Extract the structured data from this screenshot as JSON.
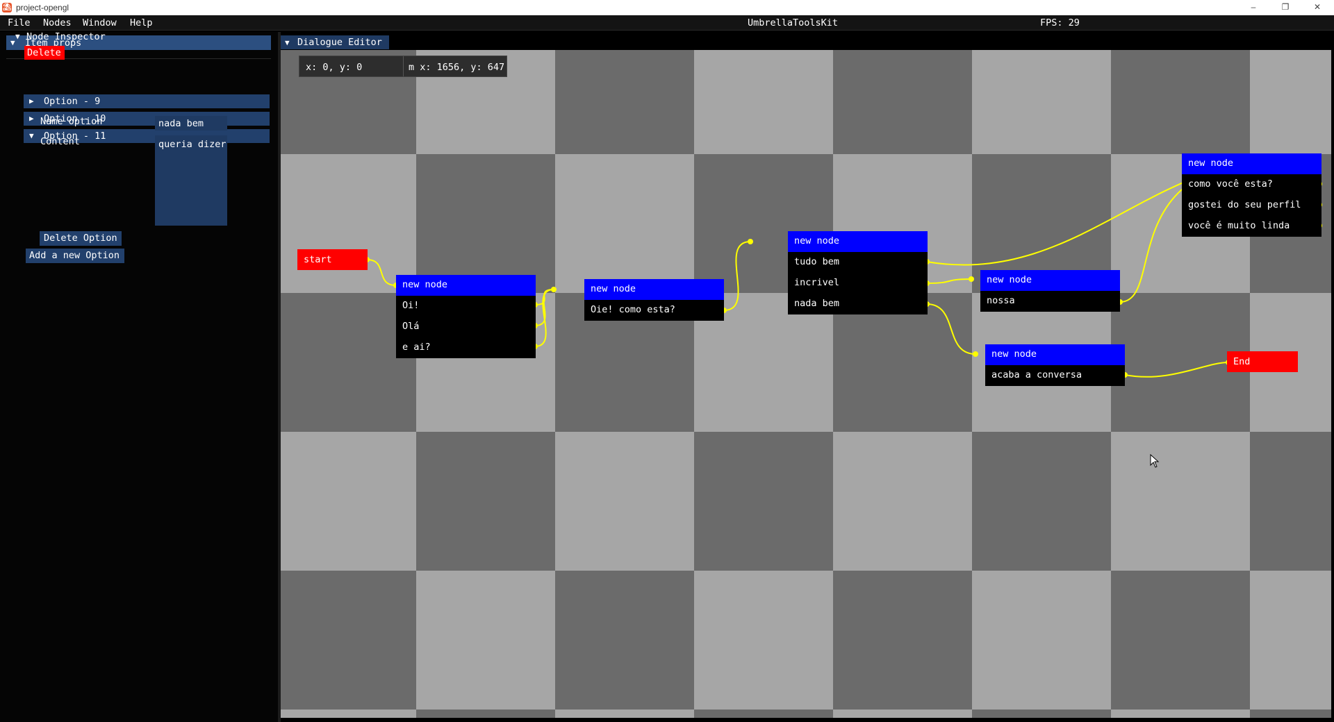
{
  "window": {
    "title": "project-opengl",
    "app_icon": "app-logo-icon",
    "controls": {
      "minimize": "–",
      "maximize": "❐",
      "close": "✕"
    }
  },
  "menubar": {
    "items": [
      "File",
      "Nodes",
      "Window",
      "Help"
    ],
    "center_title": "UmbrellaToolsKit",
    "fps": "FPS: 29"
  },
  "item_props": {
    "header": "Item props",
    "node_inspector": "Node Inspector",
    "delete_label": "Delete",
    "options": [
      {
        "label": "Option - 9",
        "expanded": false
      },
      {
        "label": "Option - 10",
        "expanded": false
      },
      {
        "label": "Option - 11",
        "expanded": true
      }
    ],
    "name_option_label": "Name option",
    "name_option_value": "nada bem",
    "content_label": "Content",
    "content_value": "queria dizer",
    "delete_option_label": "Delete Option",
    "add_option_label": "Add a new Option"
  },
  "editor": {
    "header": "Dialogue Editor",
    "coords": "x: 0, y: 0",
    "mouse_coords": "m x: 1656, y: 647",
    "colors": {
      "checker_dark": "#6b6b6b",
      "checker_light": "#a6a6a6",
      "node_header": "#0000ff",
      "connection": "#ffff00",
      "start_end": "#ff0000"
    },
    "start_label": "start",
    "end_label": "End",
    "nodes": [
      {
        "title": "new node",
        "options": [
          "Oi!",
          "Olá",
          "e ai?"
        ]
      },
      {
        "title": "new node",
        "options": [
          "Oie! como esta?"
        ]
      },
      {
        "title": "new node",
        "options": [
          "tudo bem",
          "incrivel",
          "nada bem"
        ]
      },
      {
        "title": "new node",
        "options": [
          "nossa"
        ]
      },
      {
        "title": "new node",
        "options": [
          "acaba a conversa"
        ]
      },
      {
        "title": "new node",
        "options": [
          "como você esta?",
          "gostei do seu perfil",
          "você é muito linda"
        ]
      }
    ]
  }
}
